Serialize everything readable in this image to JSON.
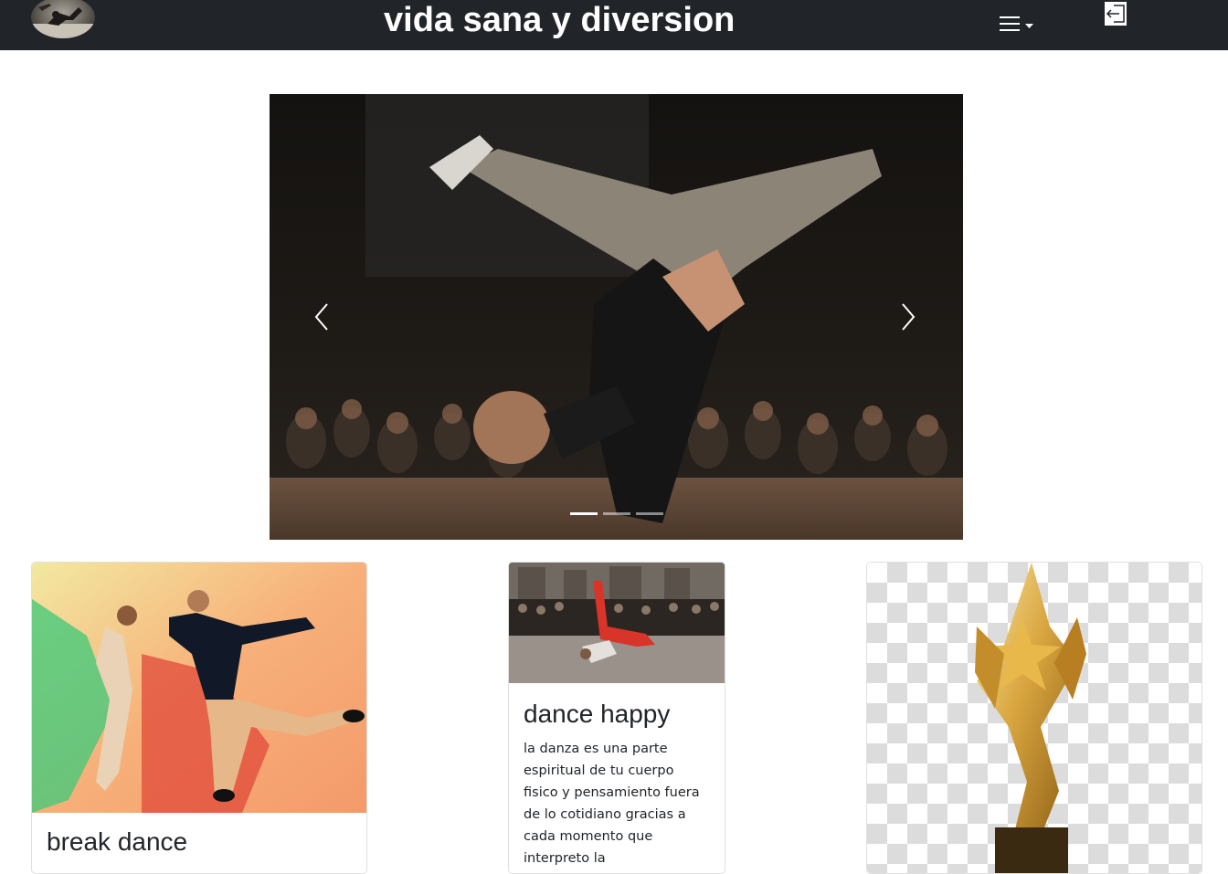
{
  "header": {
    "title": "vida sana y diversion",
    "logo_icon": "breakdancer-logo",
    "menu_icon": "hamburger-menu-icon",
    "logout_icon": "logout-icon"
  },
  "carousel": {
    "slide_count": 3,
    "active_slide": 1,
    "prev_icon": "chevron-left-icon",
    "next_icon": "chevron-right-icon"
  },
  "cards": [
    {
      "title": "break dance",
      "image": "two-dancers-jumping-photo"
    },
    {
      "title": "dance happy",
      "text": "la danza es una parte espiritual de tu cuerpo fisico y pensamiento fuera de lo cotidiano gracias a cada momento que interpreto la",
      "image": "breakdancer-crowd-photo"
    },
    {
      "image": "gold-trophy-photo"
    }
  ],
  "colors": {
    "navbar": "#212529",
    "page_bg": "#ffffff",
    "text": "#212529"
  }
}
